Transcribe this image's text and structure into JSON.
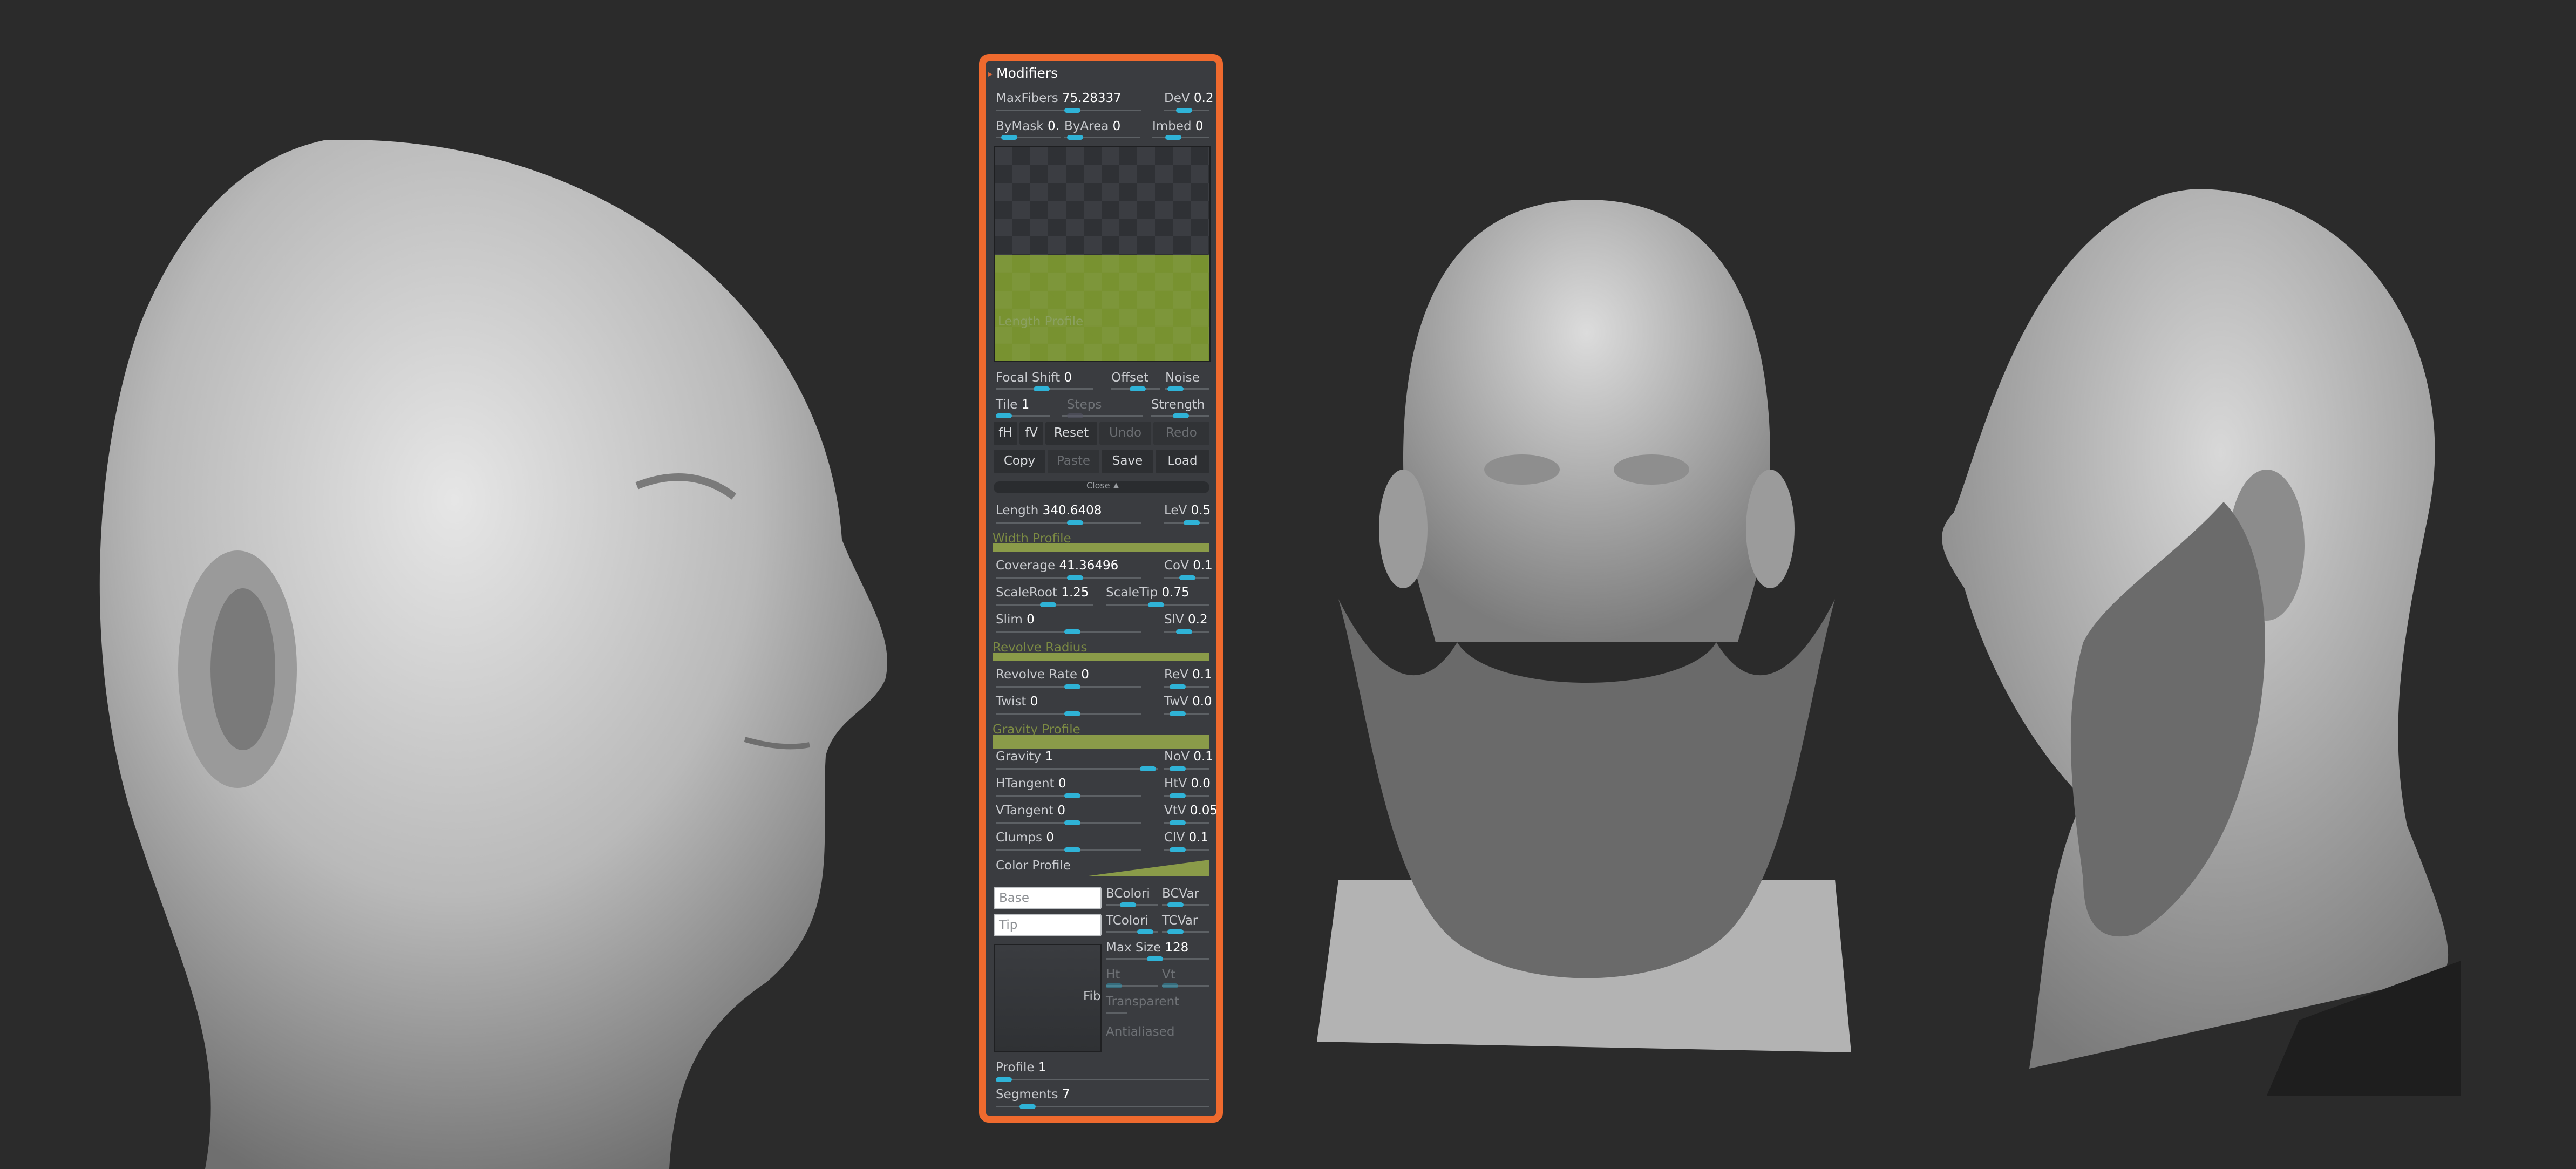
{
  "palette": {
    "title": "Modifiers",
    "max_fibers": {
      "label": "MaxFibers",
      "value": "75.28337"
    },
    "dev": {
      "label": "DeV",
      "value": "0.2"
    },
    "by_mask": {
      "label": "ByMask",
      "value": "0."
    },
    "by_area": {
      "label": "ByArea",
      "value": "0"
    },
    "imbed": {
      "label": "Imbed",
      "value": "0"
    },
    "preview_label": "Length Profile",
    "focal_shift": {
      "label": "Focal Shift",
      "value": "0"
    },
    "offset": {
      "label": "Offset"
    },
    "noise": {
      "label": "Noise"
    },
    "tile": {
      "label": "Tile",
      "value": "1"
    },
    "steps": {
      "label": "Steps"
    },
    "strength": {
      "label": "Strength"
    },
    "buttons": {
      "fh": "fH",
      "fv": "fV",
      "reset": "Reset",
      "undo": "Undo",
      "redo": "Redo",
      "copy": "Copy",
      "paste": "Paste",
      "save": "Save",
      "load": "Load"
    },
    "close_label": "Close",
    "length": {
      "label": "Length",
      "value": "340.6408"
    },
    "lev": {
      "label": "LeV",
      "value": "0.5"
    },
    "width_profile": "Width Profile",
    "coverage": {
      "label": "Coverage",
      "value": "41.36496"
    },
    "cov": {
      "label": "CoV",
      "value": "0.1"
    },
    "scale_root": {
      "label": "ScaleRoot",
      "value": "1.25"
    },
    "scale_tip": {
      "label": "ScaleTip",
      "value": "0.75"
    },
    "slim": {
      "label": "Slim",
      "value": "0"
    },
    "slv": {
      "label": "SlV",
      "value": "0.2"
    },
    "revolve_radius": "Revolve Radius",
    "revolve_rate": {
      "label": "Revolve Rate",
      "value": "0"
    },
    "rev": {
      "label": "ReV",
      "value": "0.1"
    },
    "twist": {
      "label": "Twist",
      "value": "0"
    },
    "twv": {
      "label": "TwV",
      "value": "0.0"
    },
    "gravity_profile": "Gravity Profile",
    "gravity": {
      "label": "Gravity",
      "value": "1"
    },
    "nov": {
      "label": "NoV",
      "value": "0.1"
    },
    "htangent": {
      "label": "HTangent",
      "value": "0"
    },
    "htv": {
      "label": "HtV",
      "value": "0.0"
    },
    "vtangent": {
      "label": "VTangent",
      "value": "0"
    },
    "vtv": {
      "label": "VtV",
      "value": "0.05"
    },
    "clumps": {
      "label": "Clumps",
      "value": "0"
    },
    "clv": {
      "label": "ClV",
      "value": "0.1"
    },
    "color_profile": "Color Profile",
    "base_placeholder": "Base",
    "tip_placeholder": "Tip",
    "bcolor": "BColori",
    "bcvar": "BCVar",
    "tcolor": "TColori",
    "tcvar": "TCVar",
    "max_size": {
      "label": "Max Size",
      "value": "128"
    },
    "ht": "Ht",
    "vt": "Vt",
    "fib_label": "Fib",
    "transparent": "Transparent",
    "antialiased": "Antialiased",
    "profile": {
      "label": "Profile",
      "value": "1"
    },
    "segments": {
      "label": "Segments",
      "value": "7"
    }
  },
  "colors": {
    "accent_border": "#ef6a2e",
    "slider_knob": "#2fb3d7",
    "profile_green": "#8a9b49",
    "background": "#2b2b2b"
  }
}
